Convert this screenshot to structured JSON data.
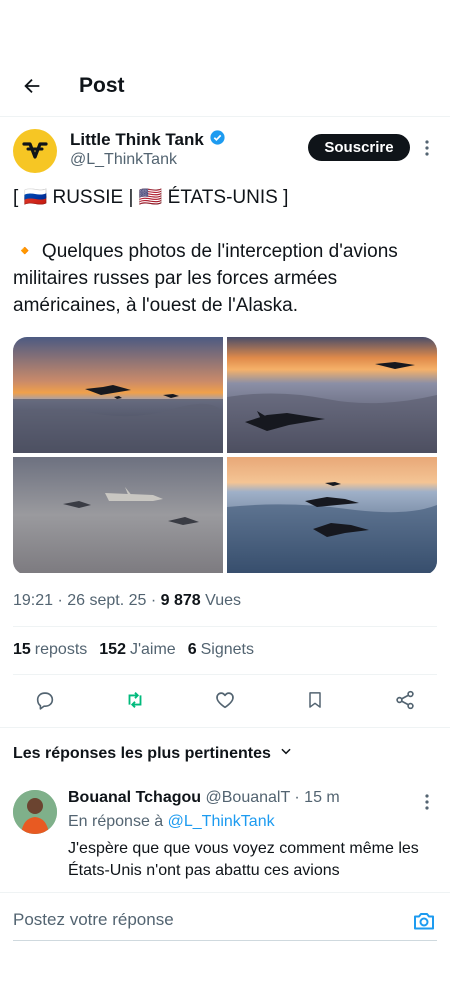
{
  "header": {
    "title": "Post"
  },
  "post": {
    "author_name": "Little Think Tank",
    "author_handle": "@L_ThinkTank",
    "subscribe_label": "Souscrire",
    "text_line1": "[ 🇷🇺 RUSSIE | 🇺🇸 ÉTATS-UNIS ]",
    "text_line2": "🔸 Quelques photos de l'interception d'avions militaires russes par les forces armées américaines, à l'ouest de l'Alaska.",
    "time_date": "19:21 · 26 sept. 25 · ",
    "views_count": "9 878",
    "views_label": " Vues",
    "stats": {
      "reposts_count": "15",
      "reposts_label": "reposts",
      "likes_count": "152",
      "likes_label": "J'aime",
      "bookmarks_count": "6",
      "bookmarks_label": "Signets"
    }
  },
  "replies": {
    "section_label": "Les réponses les plus pertinentes",
    "items": [
      {
        "name": "Bouanal Tchagou",
        "handle_time": "@BouanalT · 15 m",
        "reply_to_prefix": "En réponse à ",
        "reply_to_handle": "@L_ThinkTank",
        "text": "J'espère que que vous voyez comment même les États-Unis n'ont pas abattu ces avions"
      }
    ]
  },
  "compose": {
    "placeholder": "Postez votre réponse"
  },
  "colors": {
    "accent": "#1d9bf0",
    "repost_green": "#00ba7c",
    "muted": "#536471"
  }
}
